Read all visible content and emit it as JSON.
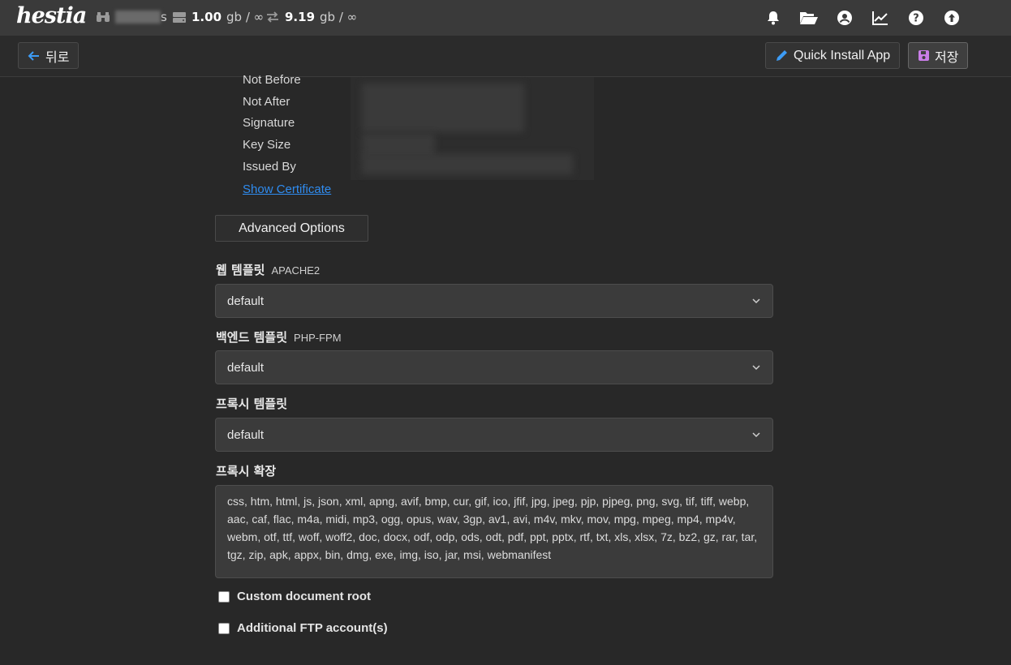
{
  "app": {
    "logo": "hestia"
  },
  "stats": {
    "user": "s",
    "disk": {
      "value": "1.00",
      "unit": "gb / ∞"
    },
    "bandwidth": {
      "value": "9.19",
      "unit": "gb / ∞"
    }
  },
  "top_icons": [
    "bell-icon",
    "folder-icon",
    "user-icon",
    "chart-icon",
    "help-icon",
    "update-icon"
  ],
  "toolbar": {
    "back_label": "뒤로",
    "quick_install_label": "Quick Install App",
    "save_label": "저장"
  },
  "certificate": {
    "labels": [
      "Not Before",
      "Not After",
      "Signature",
      "Key Size",
      "Issued By"
    ],
    "show_link": "Show Certificate"
  },
  "advanced_button": "Advanced Options",
  "web_template": {
    "label": "웹 템플릿",
    "sub": "APACHE2",
    "value": "default"
  },
  "backend_template": {
    "label": "백엔드 템플릿",
    "sub": "PHP-FPM",
    "value": "default"
  },
  "proxy_template": {
    "label": "프록시 템플릿",
    "value": "default"
  },
  "proxy_extensions": {
    "label": "프록시 확장",
    "value": "css, htm, html, js, json, xml, apng, avif, bmp, cur, gif, ico, jfif, jpg, jpeg, pjp, pjpeg, png, svg, tif, tiff, webp, aac, caf, flac, m4a, midi, mp3, ogg, opus, wav, 3gp, av1, avi, m4v, mkv, mov, mpg, mpeg, mp4, mp4v, webm, otf, ttf, woff, woff2, doc, docx, odf, odp, ods, odt, pdf, ppt, pptx, rtf, txt, xls, xlsx, 7z, bz2, gz, rar, tar, tgz, zip, apk, appx, bin, dmg, exe, img, iso, jar, msi, webmanifest"
  },
  "options": {
    "custom_doc_root": "Custom document root",
    "ftp_accounts": "Additional FTP account(s)"
  }
}
